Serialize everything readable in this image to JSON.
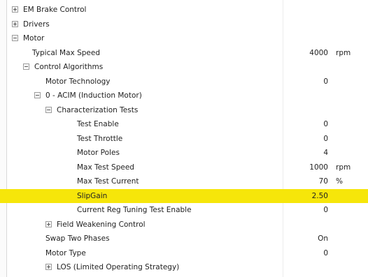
{
  "tree": [
    {
      "label": "EM Brake Control",
      "value": "",
      "unit": "",
      "toggle": "plus"
    },
    {
      "label": "Drivers",
      "value": "",
      "unit": "",
      "toggle": "plus"
    },
    {
      "label": "Motor",
      "value": "",
      "unit": "",
      "toggle": "minus"
    },
    {
      "label": "Typical Max Speed",
      "value": "4000",
      "unit": "rpm",
      "toggle": ""
    },
    {
      "label": "Control Algorithms",
      "value": "",
      "unit": "",
      "toggle": "minus"
    },
    {
      "label": "Motor Technology",
      "value": "0",
      "unit": "",
      "toggle": ""
    },
    {
      "label": "0 - ACIM (Induction Motor)",
      "value": "",
      "unit": "",
      "toggle": "minus"
    },
    {
      "label": "Characterization Tests",
      "value": "",
      "unit": "",
      "toggle": "minus"
    },
    {
      "label": "Test Enable",
      "value": "0",
      "unit": "",
      "toggle": ""
    },
    {
      "label": "Test Throttle",
      "value": "0",
      "unit": "",
      "toggle": ""
    },
    {
      "label": "Motor Poles",
      "value": "4",
      "unit": "",
      "toggle": ""
    },
    {
      "label": "Max Test Speed",
      "value": "1000",
      "unit": "rpm",
      "toggle": ""
    },
    {
      "label": "Max Test Current",
      "value": "70",
      "unit": "%",
      "toggle": ""
    },
    {
      "label": "SlipGain",
      "value": "2.50",
      "unit": "",
      "toggle": "",
      "highlighted": true
    },
    {
      "label": "Current Reg Tuning Test Enable",
      "value": "0",
      "unit": "",
      "toggle": ""
    },
    {
      "label": "Field Weakening Control",
      "value": "",
      "unit": "",
      "toggle": "plus"
    },
    {
      "label": "Swap Two Phases",
      "value": "On",
      "unit": "",
      "toggle": ""
    },
    {
      "label": "Motor Type",
      "value": "0",
      "unit": "",
      "toggle": ""
    },
    {
      "label": "LOS (Limited Operating Strategy)",
      "value": "",
      "unit": "",
      "toggle": "plus"
    }
  ],
  "colors": {
    "highlight": "#f6e60a",
    "background": "#ffffff",
    "text": "#222222"
  }
}
